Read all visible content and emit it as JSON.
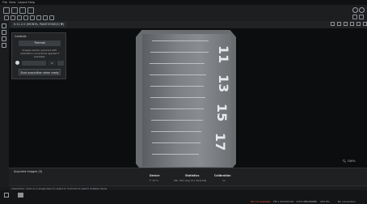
{
  "menu": [
    "File",
    "View",
    "Layout",
    "Help"
  ],
  "tab": {
    "label": "0.11.2.0 (MONTA, PAINTZONE(3) ▼)"
  },
  "controls": {
    "title": "Controls",
    "mode_label": "Thermal",
    "info_text": "Images will be acquired with calibration corrections applied if available.",
    "exposure_value": "0",
    "start_label": "Start acquisition when ready"
  },
  "xray_numbers": [
    "11",
    "13",
    "15",
    "17"
  ],
  "zoom_label": "100%",
  "acquired": {
    "title": "Acquired images (0)",
    "device_header": "Device",
    "device_value": "T: 31°C",
    "stats_header": "Statistics",
    "stats_value": "Min: 901  Avg: 8.1  16.8 bits",
    "calib_header": "Calibration",
    "calib_value": "1x"
  },
  "interaction_text": "Interaction: Click on a single item to select it, hold Ctrl to select multiple items",
  "status": {
    "warning": "XR not available",
    "a": "FM 1 231221729",
    "b": "178.5 MB/280MB",
    "c": "CPU 8%",
    "d": "No connection"
  },
  "colors": {
    "accent": "#2d8cf0",
    "warning": "#e0623a",
    "bg": "#17191b"
  }
}
